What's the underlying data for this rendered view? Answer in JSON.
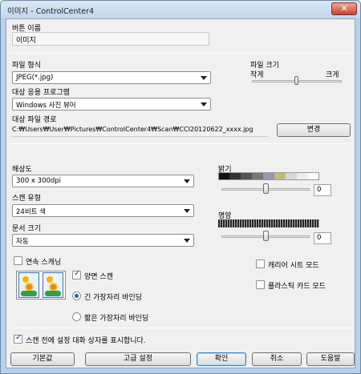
{
  "window": {
    "title": "이미지 - ControlCenter4",
    "close_glyph": "✕"
  },
  "button_name": {
    "label": "버튼 이름",
    "value": "이미지"
  },
  "file_type": {
    "label": "파일 형식",
    "value": "JPEG(*.jpg)"
  },
  "file_size": {
    "label": "파일 크기",
    "small": "작게",
    "large": "크게",
    "level_fraction": 0.5
  },
  "target_app": {
    "label": "대상 응용 프로그램",
    "value": "Windows 사진 뷰어"
  },
  "target_path": {
    "label": "대상 파일 경로",
    "value": "C:₩Users₩User₩Pictures₩ControlCenter4₩Scan₩CCI20120622_xxxx.jpg",
    "change_button": "변경"
  },
  "resolution": {
    "label": "해상도",
    "value": "300 x 300dpi"
  },
  "scan_type": {
    "label": "스캔 유형",
    "value": "24비트 색"
  },
  "doc_size": {
    "label": "문서 크기",
    "value": "자동"
  },
  "brightness": {
    "label": "밝기",
    "value": "0",
    "level_fraction": 0.5
  },
  "contrast": {
    "label": "명암",
    "value": "0",
    "level_fraction": 0.5
  },
  "continuous_scan": {
    "label": "연속 스캐닝",
    "checked": false
  },
  "duplex": {
    "label": "양면 스캔",
    "checked": true,
    "long_edge": {
      "label": "긴 가장자리 바인딩",
      "selected": true
    },
    "short_edge": {
      "label": "짧은 가장자리 바인딩",
      "selected": false
    }
  },
  "carrier_sheet": {
    "label": "캐리어 시트 모드",
    "checked": false
  },
  "plastic_card": {
    "label": "플라스틱 카드 모드",
    "checked": false
  },
  "show_dialog": {
    "label": "스캔 전에 설정 대화 상자를 표시합니다.",
    "checked": true
  },
  "footer": {
    "default_button": "기본값",
    "advanced_button": "고급 설정",
    "ok_button": "확인",
    "cancel_button": "취소",
    "help_button": "도움말"
  },
  "colors": {
    "title_bg": "#c3d6eb",
    "close_red": "#c7432e",
    "dialog_bg": "#f0f0f0",
    "accent": "#3c7fb1"
  }
}
